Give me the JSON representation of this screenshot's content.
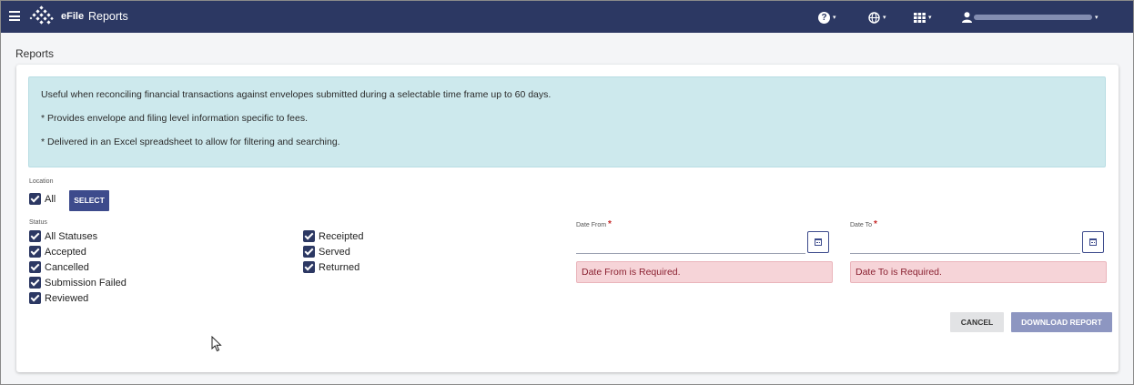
{
  "header": {
    "brand": "eFile",
    "title": "Reports",
    "help_caret": "▾",
    "language_caret": "▾",
    "apps_caret": "▾",
    "user_caret": "▾",
    "bar_color": "#2c3863"
  },
  "page": {
    "title": "Reports"
  },
  "info": {
    "line1": "Useful when reconciling financial transactions against envelopes submitted during a selectable time frame up to 60 days.",
    "line2": "* Provides envelope and filing level information specific to fees.",
    "line3": "* Delivered in an Excel spreadsheet to allow for filtering and searching."
  },
  "location": {
    "label": "Location",
    "all_label": "All",
    "all_checked": true,
    "select_button": "SELECT"
  },
  "status": {
    "label": "Status",
    "col1": [
      {
        "label": "All Statuses",
        "checked": true
      },
      {
        "label": "Accepted",
        "checked": true
      },
      {
        "label": "Cancelled",
        "checked": true
      },
      {
        "label": "Submission Failed",
        "checked": true
      },
      {
        "label": "Reviewed",
        "checked": true
      }
    ],
    "col2": [
      {
        "label": "Receipted",
        "checked": true
      },
      {
        "label": "Served",
        "checked": true
      },
      {
        "label": "Returned",
        "checked": true
      }
    ]
  },
  "date_from": {
    "label": "Date From",
    "required_mark": "*",
    "value": "",
    "error": "Date From is Required."
  },
  "date_to": {
    "label": "Date To",
    "required_mark": "*",
    "value": "",
    "error": "Date To is Required."
  },
  "actions": {
    "cancel": "CANCEL",
    "download": "DOWNLOAD REPORT"
  },
  "colors": {
    "primary": "#2c3863",
    "button": "#3d4b8c",
    "button_disabled": "#8d96c1",
    "info_bg": "#cde9ed",
    "error_bg": "#f6d4d8"
  }
}
